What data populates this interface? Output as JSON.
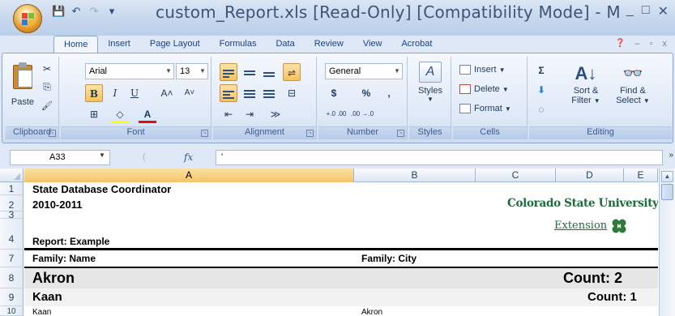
{
  "window": {
    "title": "custom_Report.xls  [Read-Only]  [Compatibility Mode] - M",
    "minimize": "_",
    "maximize": "□",
    "close": "✕"
  },
  "qat": {
    "save": "💾",
    "undo": "↶",
    "redo": "↷",
    "customize": "▾"
  },
  "tabs": [
    {
      "label": "Home",
      "active": true
    },
    {
      "label": "Insert"
    },
    {
      "label": "Page Layout"
    },
    {
      "label": "Formulas"
    },
    {
      "label": "Data"
    },
    {
      "label": "Review"
    },
    {
      "label": "View"
    },
    {
      "label": "Acrobat"
    }
  ],
  "help_ctrls": {
    "help": "❓",
    "min": "–",
    "restore": "▫",
    "close": "x"
  },
  "ribbon": {
    "clipboard": {
      "label": "Clipboard",
      "paste_label": "Paste",
      "cut": "✂",
      "copy": "⎘",
      "format_painter": "🖌"
    },
    "font": {
      "label": "Font",
      "font_name": "Arial",
      "font_size": "13",
      "bold": "B",
      "italic": "I",
      "underline": "U",
      "grow": "A˄",
      "shrink": "A˅",
      "border": "⊞",
      "fill": "◇",
      "font_color": "A"
    },
    "alignment": {
      "label": "Alignment",
      "orientation": "≫",
      "wrap": "⇌",
      "merge": "⊟"
    },
    "number": {
      "label": "Number",
      "format": "General",
      "currency": "$",
      "percent": "%",
      "comma": ",",
      "inc_decimal": "+.0 .00",
      "dec_decimal": ".00 →.0"
    },
    "styles": {
      "label": "Styles",
      "styles_label": "Styles"
    },
    "cells": {
      "label": "Cells",
      "insert": "Insert",
      "delete": "Delete",
      "format": "Format"
    },
    "editing": {
      "label": "Editing",
      "sum": "Σ",
      "fill": "⬇",
      "clear": "◌",
      "sort_line1": "Sort &",
      "sort_line2": "Filter",
      "find_line1": "Find &",
      "find_line2": "Select"
    }
  },
  "formula_bar": {
    "name_box": "A33",
    "fx": "fx",
    "content": "'"
  },
  "columns": [
    {
      "label": "A",
      "selected": true
    },
    {
      "label": "B"
    },
    {
      "label": "C"
    },
    {
      "label": "D"
    },
    {
      "label": "E"
    }
  ],
  "rows": [
    "1",
    "2",
    "3",
    "4",
    "7",
    "8",
    "9",
    "10"
  ],
  "sheet": {
    "title": "State Database Coordinator",
    "year": "2010-2011",
    "report": "Report: Example",
    "header_name": "Family: Name",
    "header_city": "Family: City",
    "group1_name": "Akron",
    "group1_count": "Count: 2",
    "group2_name": "Kaan",
    "group2_count": "Count: 1",
    "row10_name": "Kaan",
    "row10_city": "Akron"
  },
  "logo": {
    "line1": "Colorado State University",
    "line2": "Extension"
  },
  "colors": {
    "accent_selected": "#f5c36a",
    "logo_green": "#2f7a3a",
    "logo_text": "#1e6b3a"
  }
}
